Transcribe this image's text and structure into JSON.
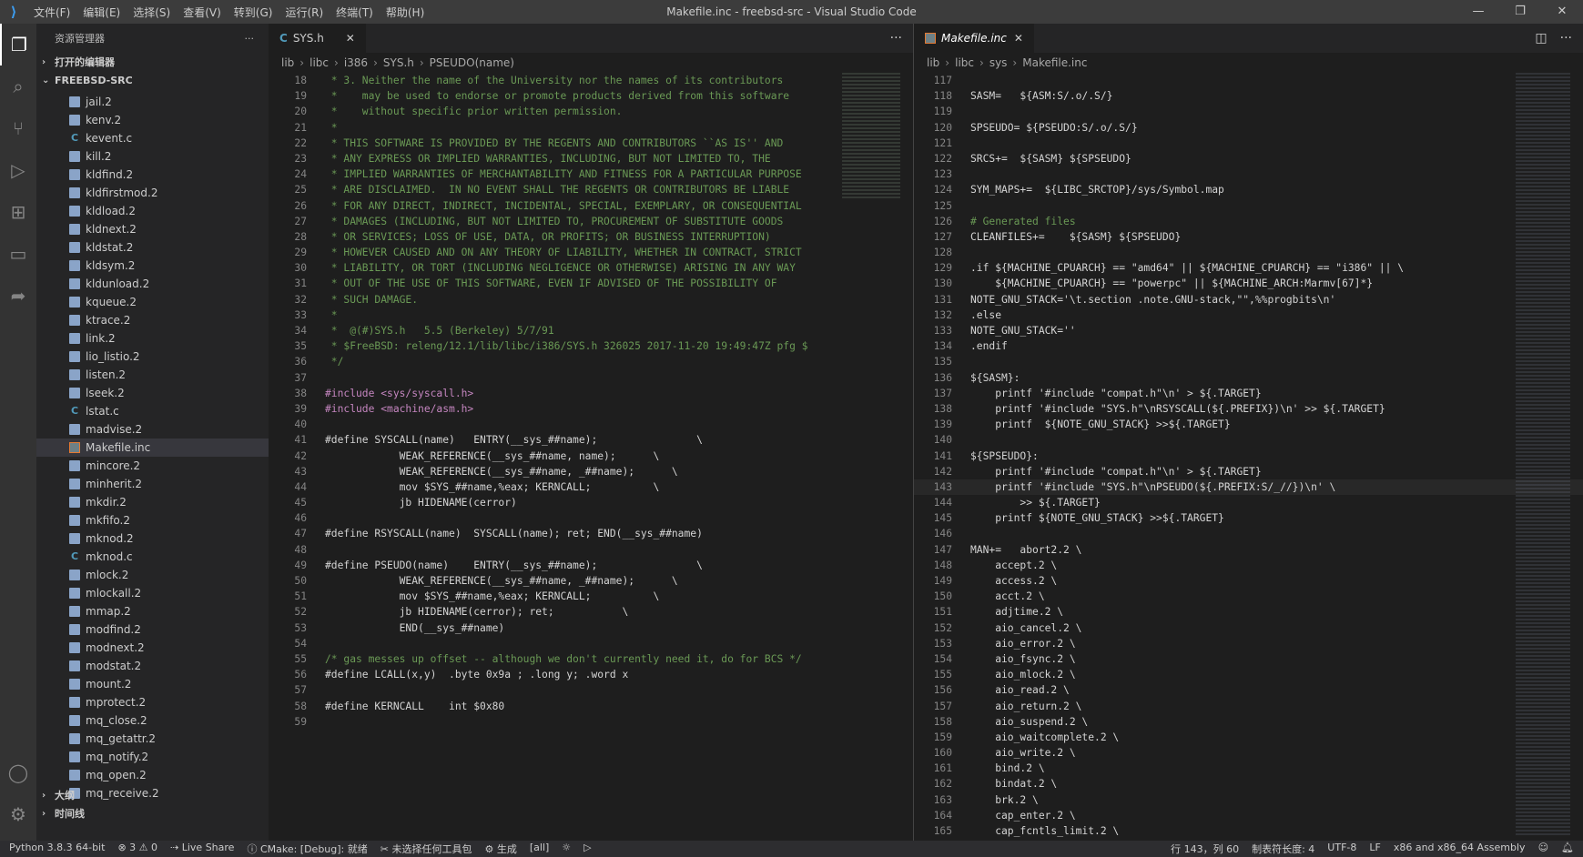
{
  "window": {
    "title": "Makefile.inc - freebsd-src - Visual Studio Code",
    "menu": [
      "文件(F)",
      "编辑(E)",
      "选择(S)",
      "查看(V)",
      "转到(G)",
      "运行(R)",
      "终端(T)",
      "帮助(H)"
    ]
  },
  "activity": [
    "files-icon",
    "search-icon",
    "source-control-icon",
    "run-debug-icon",
    "extensions-icon",
    "remote-explorer-icon",
    "live-share-icon"
  ],
  "sidebar": {
    "header": "资源管理器",
    "sections": {
      "open_editors": "打开的编辑器",
      "root": "FREEBSD-SRC",
      "outline": "大纲",
      "timeline": "时间线"
    },
    "files": [
      {
        "name": "jail.2",
        "type": "doc"
      },
      {
        "name": "kenv.2",
        "type": "doc"
      },
      {
        "name": "kevent.c",
        "type": "c"
      },
      {
        "name": "kill.2",
        "type": "doc"
      },
      {
        "name": "kldfind.2",
        "type": "doc"
      },
      {
        "name": "kldfirstmod.2",
        "type": "doc"
      },
      {
        "name": "kldload.2",
        "type": "doc"
      },
      {
        "name": "kldnext.2",
        "type": "doc"
      },
      {
        "name": "kldstat.2",
        "type": "doc"
      },
      {
        "name": "kldsym.2",
        "type": "doc"
      },
      {
        "name": "kldunload.2",
        "type": "doc"
      },
      {
        "name": "kqueue.2",
        "type": "doc"
      },
      {
        "name": "ktrace.2",
        "type": "doc"
      },
      {
        "name": "link.2",
        "type": "doc"
      },
      {
        "name": "lio_listio.2",
        "type": "doc"
      },
      {
        "name": "listen.2",
        "type": "doc"
      },
      {
        "name": "lseek.2",
        "type": "doc"
      },
      {
        "name": "lstat.c",
        "type": "c"
      },
      {
        "name": "madvise.2",
        "type": "doc"
      },
      {
        "name": "Makefile.inc",
        "type": "mk",
        "selected": true
      },
      {
        "name": "mincore.2",
        "type": "doc"
      },
      {
        "name": "minherit.2",
        "type": "doc"
      },
      {
        "name": "mkdir.2",
        "type": "doc"
      },
      {
        "name": "mkfifo.2",
        "type": "doc"
      },
      {
        "name": "mknod.2",
        "type": "doc"
      },
      {
        "name": "mknod.c",
        "type": "c"
      },
      {
        "name": "mlock.2",
        "type": "doc"
      },
      {
        "name": "mlockall.2",
        "type": "doc"
      },
      {
        "name": "mmap.2",
        "type": "doc"
      },
      {
        "name": "modfind.2",
        "type": "doc"
      },
      {
        "name": "modnext.2",
        "type": "doc"
      },
      {
        "name": "modstat.2",
        "type": "doc"
      },
      {
        "name": "mount.2",
        "type": "doc"
      },
      {
        "name": "mprotect.2",
        "type": "doc"
      },
      {
        "name": "mq_close.2",
        "type": "doc"
      },
      {
        "name": "mq_getattr.2",
        "type": "doc"
      },
      {
        "name": "mq_notify.2",
        "type": "doc"
      },
      {
        "name": "mq_open.2",
        "type": "doc"
      },
      {
        "name": "mq_receive.2",
        "type": "doc"
      }
    ]
  },
  "editor1": {
    "tab": "SYS.h",
    "tab_icon": "C",
    "breadcrumb": [
      "lib",
      "libc",
      "i386",
      "SYS.h",
      "PSEUDO(name)"
    ],
    "lines": [
      {
        "n": "18",
        "t": " * 3. Neither the name of the University nor the names of its contributors",
        "k": "cm"
      },
      {
        "n": "19",
        "t": " *    may be used to endorse or promote products derived from this software",
        "k": "cm"
      },
      {
        "n": "20",
        "t": " *    without specific prior written permission.",
        "k": "cm"
      },
      {
        "n": "21",
        "t": " *",
        "k": "cm"
      },
      {
        "n": "22",
        "t": " * THIS SOFTWARE IS PROVIDED BY THE REGENTS AND CONTRIBUTORS ``AS IS'' AND",
        "k": "cm"
      },
      {
        "n": "23",
        "t": " * ANY EXPRESS OR IMPLIED WARRANTIES, INCLUDING, BUT NOT LIMITED TO, THE",
        "k": "cm"
      },
      {
        "n": "24",
        "t": " * IMPLIED WARRANTIES OF MERCHANTABILITY AND FITNESS FOR A PARTICULAR PURPOSE",
        "k": "cm"
      },
      {
        "n": "25",
        "t": " * ARE DISCLAIMED.  IN NO EVENT SHALL THE REGENTS OR CONTRIBUTORS BE LIABLE",
        "k": "cm"
      },
      {
        "n": "26",
        "t": " * FOR ANY DIRECT, INDIRECT, INCIDENTAL, SPECIAL, EXEMPLARY, OR CONSEQUENTIAL",
        "k": "cm"
      },
      {
        "n": "27",
        "t": " * DAMAGES (INCLUDING, BUT NOT LIMITED TO, PROCUREMENT OF SUBSTITUTE GOODS",
        "k": "cm"
      },
      {
        "n": "28",
        "t": " * OR SERVICES; LOSS OF USE, DATA, OR PROFITS; OR BUSINESS INTERRUPTION)",
        "k": "cm"
      },
      {
        "n": "29",
        "t": " * HOWEVER CAUSED AND ON ANY THEORY OF LIABILITY, WHETHER IN CONTRACT, STRICT",
        "k": "cm"
      },
      {
        "n": "30",
        "t": " * LIABILITY, OR TORT (INCLUDING NEGLIGENCE OR OTHERWISE) ARISING IN ANY WAY",
        "k": "cm"
      },
      {
        "n": "31",
        "t": " * OUT OF THE USE OF THIS SOFTWARE, EVEN IF ADVISED OF THE POSSIBILITY OF",
        "k": "cm"
      },
      {
        "n": "32",
        "t": " * SUCH DAMAGE.",
        "k": "cm"
      },
      {
        "n": "33",
        "t": " *",
        "k": "cm"
      },
      {
        "n": "34",
        "t": " *  @(#)SYS.h   5.5 (Berkeley) 5/7/91",
        "k": "cm"
      },
      {
        "n": "35",
        "t": " * $FreeBSD: releng/12.1/lib/libc/i386/SYS.h 326025 2017-11-20 19:49:47Z pfg $",
        "k": "cm"
      },
      {
        "n": "36",
        "t": " */",
        "k": "cm"
      },
      {
        "n": "37",
        "t": "",
        "k": ""
      },
      {
        "n": "38",
        "t": "#include <sys/syscall.h>",
        "k": "pp"
      },
      {
        "n": "39",
        "t": "#include <machine/asm.h>",
        "k": "pp"
      },
      {
        "n": "40",
        "t": "",
        "k": ""
      },
      {
        "n": "41",
        "t": "#define SYSCALL(name)   ENTRY(__sys_##name);                \\",
        "k": ""
      },
      {
        "n": "42",
        "t": "            WEAK_REFERENCE(__sys_##name, name);      \\",
        "k": ""
      },
      {
        "n": "43",
        "t": "            WEAK_REFERENCE(__sys_##name, _##name);      \\",
        "k": ""
      },
      {
        "n": "44",
        "t": "            mov $SYS_##name,%eax; KERNCALL;          \\",
        "k": ""
      },
      {
        "n": "45",
        "t": "            jb HIDENAME(cerror)",
        "k": ""
      },
      {
        "n": "46",
        "t": "",
        "k": ""
      },
      {
        "n": "47",
        "t": "#define RSYSCALL(name)  SYSCALL(name); ret; END(__sys_##name)",
        "k": ""
      },
      {
        "n": "48",
        "t": "",
        "k": ""
      },
      {
        "n": "49",
        "t": "#define PSEUDO(name)    ENTRY(__sys_##name);                \\",
        "k": ""
      },
      {
        "n": "50",
        "t": "            WEAK_REFERENCE(__sys_##name, _##name);      \\",
        "k": ""
      },
      {
        "n": "51",
        "t": "            mov $SYS_##name,%eax; KERNCALL;          \\",
        "k": ""
      },
      {
        "n": "52",
        "t": "            jb HIDENAME(cerror); ret;           \\",
        "k": ""
      },
      {
        "n": "53",
        "t": "            END(__sys_##name)",
        "k": ""
      },
      {
        "n": "54",
        "t": "",
        "k": ""
      },
      {
        "n": "55",
        "t": "/* gas messes up offset -- although we don't currently need it, do for BCS */",
        "k": "cm"
      },
      {
        "n": "56",
        "t": "#define LCALL(x,y)  .byte 0x9a ; .long y; .word x",
        "k": ""
      },
      {
        "n": "57",
        "t": "",
        "k": ""
      },
      {
        "n": "58",
        "t": "#define KERNCALL    int $0x80",
        "k": ""
      },
      {
        "n": "59",
        "t": "",
        "k": ""
      }
    ]
  },
  "editor2": {
    "tab": "Makefile.inc",
    "breadcrumb": [
      "lib",
      "libc",
      "sys",
      "Makefile.inc"
    ],
    "lines": [
      {
        "n": "117",
        "t": ""
      },
      {
        "n": "118",
        "t": "SASM=   ${ASM:S/.o/.S/}"
      },
      {
        "n": "119",
        "t": ""
      },
      {
        "n": "120",
        "t": "SPSEUDO= ${PSEUDO:S/.o/.S/}"
      },
      {
        "n": "121",
        "t": ""
      },
      {
        "n": "122",
        "t": "SRCS+=  ${SASM} ${SPSEUDO}"
      },
      {
        "n": "123",
        "t": ""
      },
      {
        "n": "124",
        "t": "SYM_MAPS+=  ${LIBC_SRCTOP}/sys/Symbol.map"
      },
      {
        "n": "125",
        "t": ""
      },
      {
        "n": "126",
        "t": "# Generated files",
        "k": "cm"
      },
      {
        "n": "127",
        "t": "CLEANFILES+=    ${SASM} ${SPSEUDO}"
      },
      {
        "n": "128",
        "t": ""
      },
      {
        "n": "129",
        "t": ".if ${MACHINE_CPUARCH} == \"amd64\" || ${MACHINE_CPUARCH} == \"i386\" || \\"
      },
      {
        "n": "130",
        "t": "    ${MACHINE_CPUARCH} == \"powerpc\" || ${MACHINE_ARCH:Marmv[67]*}"
      },
      {
        "n": "131",
        "t": "NOTE_GNU_STACK='\\t.section .note.GNU-stack,\"\",%%progbits\\n'"
      },
      {
        "n": "132",
        "t": ".else"
      },
      {
        "n": "133",
        "t": "NOTE_GNU_STACK=''"
      },
      {
        "n": "134",
        "t": ".endif"
      },
      {
        "n": "135",
        "t": ""
      },
      {
        "n": "136",
        "t": "${SASM}:"
      },
      {
        "n": "137",
        "t": "    printf '#include \"compat.h\"\\n' > ${.TARGET}"
      },
      {
        "n": "138",
        "t": "    printf '#include \"SYS.h\"\\nRSYSCALL(${.PREFIX})\\n' >> ${.TARGET}"
      },
      {
        "n": "139",
        "t": "    printf  ${NOTE_GNU_STACK} >>${.TARGET}"
      },
      {
        "n": "140",
        "t": ""
      },
      {
        "n": "141",
        "t": "${SPSEUDO}:"
      },
      {
        "n": "142",
        "t": "    printf '#include \"compat.h\"\\n' > ${.TARGET}"
      },
      {
        "n": "143",
        "t": "    printf '#include \"SYS.h\"\\nPSEUDO(${.PREFIX:S/_//})\\n' \\",
        "hl": true
      },
      {
        "n": "144",
        "t": "        >> ${.TARGET}"
      },
      {
        "n": "145",
        "t": "    printf ${NOTE_GNU_STACK} >>${.TARGET}"
      },
      {
        "n": "146",
        "t": ""
      },
      {
        "n": "147",
        "t": "MAN+=   abort2.2 \\"
      },
      {
        "n": "148",
        "t": "    accept.2 \\"
      },
      {
        "n": "149",
        "t": "    access.2 \\"
      },
      {
        "n": "150",
        "t": "    acct.2 \\"
      },
      {
        "n": "151",
        "t": "    adjtime.2 \\"
      },
      {
        "n": "152",
        "t": "    aio_cancel.2 \\"
      },
      {
        "n": "153",
        "t": "    aio_error.2 \\"
      },
      {
        "n": "154",
        "t": "    aio_fsync.2 \\"
      },
      {
        "n": "155",
        "t": "    aio_mlock.2 \\"
      },
      {
        "n": "156",
        "t": "    aio_read.2 \\"
      },
      {
        "n": "157",
        "t": "    aio_return.2 \\"
      },
      {
        "n": "158",
        "t": "    aio_suspend.2 \\"
      },
      {
        "n": "159",
        "t": "    aio_waitcomplete.2 \\"
      },
      {
        "n": "160",
        "t": "    aio_write.2 \\"
      },
      {
        "n": "161",
        "t": "    bind.2 \\"
      },
      {
        "n": "162",
        "t": "    bindat.2 \\"
      },
      {
        "n": "163",
        "t": "    brk.2 \\"
      },
      {
        "n": "164",
        "t": "    cap_enter.2 \\"
      },
      {
        "n": "165",
        "t": "    cap_fcntls_limit.2 \\"
      }
    ]
  },
  "status": {
    "python": "Python 3.8.3 64-bit",
    "problems": "⊗ 3 ⚠ 0",
    "live_share": "Live Share",
    "cmake": "CMake: [Debug]: 就绪",
    "kit": "未选择任何工具包",
    "build": "生成",
    "target": "[all]",
    "position": "行 143，列 60",
    "tab_size": "制表符长度: 4",
    "encoding": "UTF-8",
    "eol": "LF",
    "platform": "x86 and x86_64 Assembly"
  }
}
